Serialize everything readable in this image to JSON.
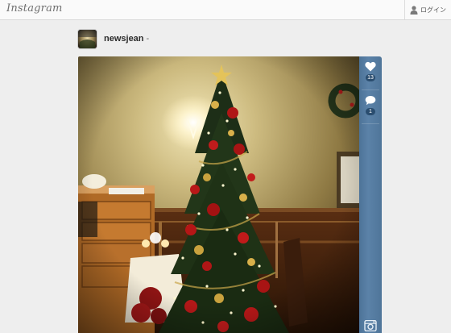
{
  "header": {
    "logo_text": "Instagram",
    "login_label": "ログイン"
  },
  "post": {
    "username": "newsjean",
    "separator": "-",
    "likes_count": "13",
    "comments_count": "1"
  },
  "colors": {
    "sidebar_blue": "#5b82a8",
    "badge_blue": "#2a4d6f",
    "page_bg": "#eeeeee"
  },
  "icons": {
    "user": "user-icon",
    "like": "heart-icon",
    "comment": "comment-bubble-icon",
    "instagram": "instagram-camera-icon"
  }
}
